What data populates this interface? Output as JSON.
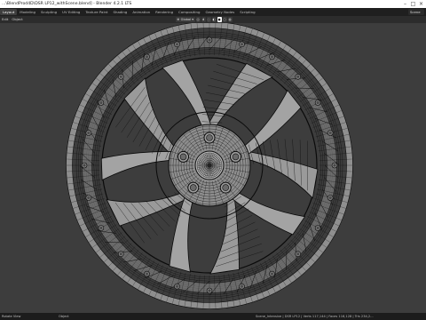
{
  "window": {
    "title": "...\\BlendProd4D\\DSR LP12_withScene.blend] - Blender 4.2.1 LTS"
  },
  "workspaces": [
    "Layout",
    "Modeling",
    "Sculpting",
    "UV Editing",
    "Texture Paint",
    "Shading",
    "Animation",
    "Rendering",
    "Compositing",
    "Geometry Nodes",
    "Scripting"
  ],
  "active_workspace": "Layout",
  "scene_field": "Scene",
  "header": {
    "mode": "Edit",
    "menu": [
      "Object"
    ],
    "transform_orientation": "Global"
  },
  "status": {
    "left": "Rotate View",
    "mid": "Object",
    "right": "Scene_Intensive | DSR LP12 | Verts 117,144 | Faces 116,128 | Tris 234,2..."
  },
  "colors": {
    "viewport_bg": "#3d3d3d",
    "wire": "#0a0a0a",
    "mesh_face": "#9a9a9a"
  }
}
